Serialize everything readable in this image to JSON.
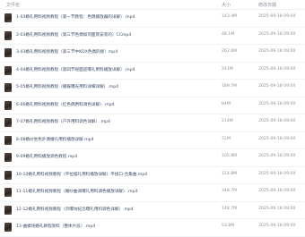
{
  "header": {
    "name_label": "文件名",
    "size_label": "大小",
    "date_label": "修改日期"
  },
  "files": [
    {
      "name": "1-03婚礼用料视频教程（第一节教程：色偶播放器的详解）.mp4",
      "size": "143.4M",
      "date": "2025-09-18 09:00"
    },
    {
      "name": "2-03婚礼用料视频教程（第三节色偶如何面景安装的）CCmp4",
      "size": "48.1M",
      "date": "2025-09-18 09:00"
    },
    {
      "name": "3-03婚礼用料视频教程（第三节中KDX色偶的接）mp4",
      "size": "262.6M",
      "date": "2025-09-18 09:00"
    },
    {
      "name": "4-04婚礼用料视频教程（第四节视面迎曝礼用料播放详解）.mp4",
      "size": "241M",
      "date": "2025-09-18 09:00"
    },
    {
      "name": "5-05婚礼用料视频教程（播报曝光用料详细详解）.mp4",
      "size": "189.7M",
      "date": "2025-09-18 09:00"
    },
    {
      "name": "6-06婚礼用料视频教程（红色偶用料调色详解）.mp4",
      "size": "84M",
      "date": "2025-09-18 09:00"
    },
    {
      "name": "7-07婚礼用料视频教程（户外用料调色详解）.mp4",
      "size": "214M",
      "date": "2025-09-18 09:00"
    },
    {
      "name": "8-08婚纱坐色外偶婚礼用料播放详解.mp4",
      "size": "72M",
      "date": "2025-09-18 09:00"
    },
    {
      "name": "9-09婚礼用料播放调色教程.mp4",
      "size": "105.8M",
      "date": "2025-09-18 09:00"
    },
    {
      "name": "10-10婚礼用料视频教程（平拉摆礼用料播放详解）平接口-合集曲.mp4",
      "size": "114.8M",
      "date": "2025-09-18 09:00"
    },
    {
      "name": "11-11婚礼用料视频教程（婚纱曲调曝礼用料调色播放详解）.mp4",
      "size": "348.7M",
      "date": "2025-09-18 09:00"
    },
    {
      "name": "12-12婚礼用料视频教程（示曝坊纪念曝礼用料调色详解）.mp4",
      "size": "148.7M",
      "date": "2025-09-18 09:00"
    },
    {
      "name": "13-曲模块婚礼教程资料（整体片段）.mp4",
      "size": "53.8M",
      "date": "2025-09-18 09:00"
    }
  ],
  "colors": {
    "link_text": "#3b4a66",
    "meta_text": "#8a8f99",
    "divider": "#f2f3f5"
  }
}
